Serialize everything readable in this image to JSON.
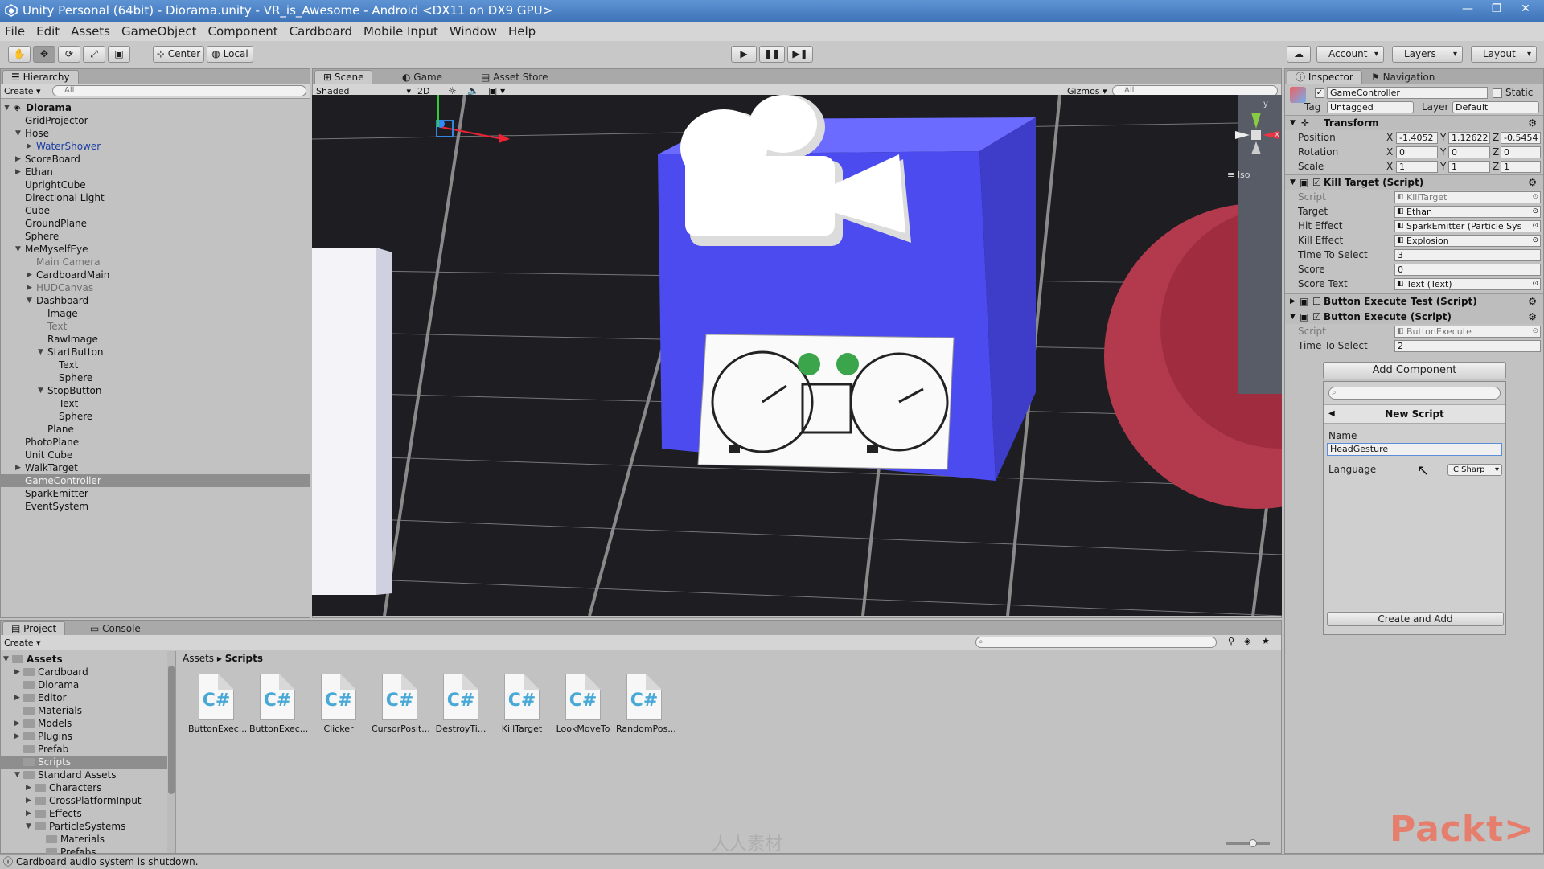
{
  "window": {
    "title": "Unity Personal (64bit) - Diorama.unity - VR_is_Awesome - Android <DX11 on DX9 GPU>"
  },
  "menu": [
    "File",
    "Edit",
    "Assets",
    "GameObject",
    "Component",
    "Cardboard",
    "Mobile Input",
    "Window",
    "Help"
  ],
  "toolbar": {
    "pivot": "Center",
    "space": "Local",
    "account": "Account",
    "layers": "Layers",
    "layout": "Layout"
  },
  "hierarchy": {
    "tab": "Hierarchy",
    "create": "Create",
    "search_placeholder": "All",
    "root": "Diorama",
    "items": [
      {
        "label": "GridProjector",
        "depth": 1,
        "arrow": "",
        "style": "normal"
      },
      {
        "label": "Hose",
        "depth": 1,
        "arrow": "open",
        "style": "normal"
      },
      {
        "label": "WaterShower",
        "depth": 2,
        "arrow": "closed",
        "style": "prefab"
      },
      {
        "label": "ScoreBoard",
        "depth": 1,
        "arrow": "closed",
        "style": "normal"
      },
      {
        "label": "Ethan",
        "depth": 1,
        "arrow": "closed",
        "style": "normal"
      },
      {
        "label": "UprightCube",
        "depth": 1,
        "arrow": "",
        "style": "normal"
      },
      {
        "label": "Directional Light",
        "depth": 1,
        "arrow": "",
        "style": "normal"
      },
      {
        "label": "Cube",
        "depth": 1,
        "arrow": "",
        "style": "normal"
      },
      {
        "label": "GroundPlane",
        "depth": 1,
        "arrow": "",
        "style": "normal"
      },
      {
        "label": "Sphere",
        "depth": 1,
        "arrow": "",
        "style": "normal"
      },
      {
        "label": "MeMyselfEye",
        "depth": 1,
        "arrow": "open",
        "style": "normal"
      },
      {
        "label": "Main Camera",
        "depth": 2,
        "arrow": "",
        "style": "inactive"
      },
      {
        "label": "CardboardMain",
        "depth": 2,
        "arrow": "closed",
        "style": "normal"
      },
      {
        "label": "HUDCanvas",
        "depth": 2,
        "arrow": "closed",
        "style": "inactive"
      },
      {
        "label": "Dashboard",
        "depth": 2,
        "arrow": "open",
        "style": "normal"
      },
      {
        "label": "Image",
        "depth": 3,
        "arrow": "",
        "style": "normal"
      },
      {
        "label": "Text",
        "depth": 3,
        "arrow": "",
        "style": "inactive"
      },
      {
        "label": "RawImage",
        "depth": 3,
        "arrow": "",
        "style": "normal"
      },
      {
        "label": "StartButton",
        "depth": 3,
        "arrow": "open",
        "style": "normal"
      },
      {
        "label": "Text",
        "depth": 4,
        "arrow": "",
        "style": "normal"
      },
      {
        "label": "Sphere",
        "depth": 4,
        "arrow": "",
        "style": "normal"
      },
      {
        "label": "StopButton",
        "depth": 3,
        "arrow": "open",
        "style": "normal"
      },
      {
        "label": "Text",
        "depth": 4,
        "arrow": "",
        "style": "normal"
      },
      {
        "label": "Sphere",
        "depth": 4,
        "arrow": "",
        "style": "normal"
      },
      {
        "label": "Plane",
        "depth": 3,
        "arrow": "",
        "style": "normal"
      },
      {
        "label": "PhotoPlane",
        "depth": 1,
        "arrow": "",
        "style": "normal"
      },
      {
        "label": "Unit Cube",
        "depth": 1,
        "arrow": "",
        "style": "normal"
      },
      {
        "label": "WalkTarget",
        "depth": 1,
        "arrow": "closed",
        "style": "normal"
      },
      {
        "label": "GameController",
        "depth": 1,
        "arrow": "",
        "style": "selected"
      },
      {
        "label": "SparkEmitter",
        "depth": 1,
        "arrow": "",
        "style": "normal"
      },
      {
        "label": "EventSystem",
        "depth": 1,
        "arrow": "",
        "style": "normal"
      }
    ]
  },
  "scene": {
    "tabs": [
      "Scene",
      "Game",
      "Asset Store"
    ],
    "shading": "Shaded",
    "mode_2d": "2D",
    "gizmos": "Gizmos",
    "search_placeholder": "All",
    "projection": "Iso",
    "gizmo_axes": {
      "y": "y",
      "x": "x"
    }
  },
  "inspector": {
    "tabs": [
      "Inspector",
      "Navigation"
    ],
    "object_name": "GameController",
    "static_label": "Static",
    "tag_label": "Tag",
    "tag": "Untagged",
    "layer_label": "Layer",
    "layer": "Default",
    "transform": {
      "title": "Transform",
      "rows": [
        {
          "label": "Position",
          "x": "-1.4052",
          "y": "1.12622",
          "z": "-0.5454"
        },
        {
          "label": "Rotation",
          "x": "0",
          "y": "0",
          "z": "0"
        },
        {
          "label": "Scale",
          "x": "1",
          "y": "1",
          "z": "1"
        }
      ],
      "axis_x": "X",
      "axis_y": "Y",
      "axis_z": "Z"
    },
    "kill_target": {
      "title": "Kill Target (Script)",
      "rows": [
        {
          "label": "Script",
          "value": "KillTarget",
          "kind": "script"
        },
        {
          "label": "Target",
          "value": "Ethan",
          "kind": "ref"
        },
        {
          "label": "Hit Effect",
          "value": "SparkEmitter (Particle Sys",
          "kind": "ref"
        },
        {
          "label": "Kill Effect",
          "value": "Explosion",
          "kind": "ref"
        },
        {
          "label": "Time To Select",
          "value": "3",
          "kind": "num"
        },
        {
          "label": "Score",
          "value": "0",
          "kind": "num"
        },
        {
          "label": "Score Text",
          "value": "Text (Text)",
          "kind": "ref"
        }
      ]
    },
    "button_execute_test": {
      "title": "Button Execute Test (Script)"
    },
    "button_execute": {
      "title": "Button Execute (Script)",
      "rows": [
        {
          "label": "Script",
          "value": "ButtonExecute",
          "kind": "script"
        },
        {
          "label": "Time To Select",
          "value": "2",
          "kind": "num"
        }
      ]
    },
    "add_component": "Add Component",
    "new_script": {
      "title": "New Script",
      "name_label": "Name",
      "name_value": "HeadGesture",
      "language_label": "Language",
      "language_value": "C Sharp",
      "create_button": "Create and Add"
    }
  },
  "project": {
    "tabs": [
      "Project",
      "Console"
    ],
    "create": "Create",
    "tree": [
      {
        "label": "Assets",
        "depth": 0,
        "arrow": "open",
        "bold": true
      },
      {
        "label": "Cardboard",
        "depth": 1,
        "arrow": "closed"
      },
      {
        "label": "Diorama",
        "depth": 1,
        "arrow": ""
      },
      {
        "label": "Editor",
        "depth": 1,
        "arrow": "closed"
      },
      {
        "label": "Materials",
        "depth": 1,
        "arrow": ""
      },
      {
        "label": "Models",
        "depth": 1,
        "arrow": "closed"
      },
      {
        "label": "Plugins",
        "depth": 1,
        "arrow": "closed"
      },
      {
        "label": "Prefab",
        "depth": 1,
        "arrow": ""
      },
      {
        "label": "Scripts",
        "depth": 1,
        "arrow": "",
        "selected": true
      },
      {
        "label": "Standard Assets",
        "depth": 1,
        "arrow": "open"
      },
      {
        "label": "Characters",
        "depth": 2,
        "arrow": "closed"
      },
      {
        "label": "CrossPlatformInput",
        "depth": 2,
        "arrow": "closed"
      },
      {
        "label": "Effects",
        "depth": 2,
        "arrow": "closed"
      },
      {
        "label": "ParticleSystems",
        "depth": 2,
        "arrow": "open"
      },
      {
        "label": "Materials",
        "depth": 3,
        "arrow": ""
      },
      {
        "label": "Prefabs",
        "depth": 3,
        "arrow": ""
      }
    ],
    "breadcrumb": [
      "Assets",
      "Scripts"
    ],
    "assets": [
      "ButtonExec...",
      "ButtonExec...",
      "Clicker",
      "CursorPosit...",
      "DestroyTi...",
      "KillTarget",
      "LookMoveTo",
      "RandomPos..."
    ],
    "asset_icon_text": "C#"
  },
  "status": "Cardboard audio system is shutdown.",
  "watermark": {
    "brand": "Packt>",
    "site": "人人素材"
  },
  "colors": {
    "title_bar": "#4a80c6",
    "selection": "#8e8e8e",
    "scene_bg": "#1d1d22",
    "cube": "#5757f0",
    "sphere": "#9c2436"
  }
}
